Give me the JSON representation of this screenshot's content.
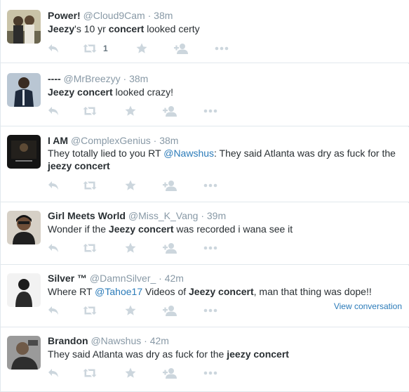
{
  "tweets": [
    {
      "fullname": "Power!",
      "username": "@Cloud9Cam",
      "sep": "·",
      "time": "38m",
      "text": [
        {
          "t": "Jeezy",
          "b": true
        },
        {
          "t": "'s 10 yr "
        },
        {
          "t": "concert",
          "b": true
        },
        {
          "t": " looked certy"
        }
      ],
      "retweet_count": "1"
    },
    {
      "fullname": "----",
      "username": "@MrBreezyy",
      "sep": "·",
      "time": "38m",
      "text": [
        {
          "t": "Jeezy concert",
          "b": true
        },
        {
          "t": " looked crazy!"
        }
      ],
      "retweet_count": ""
    },
    {
      "fullname": "I AM",
      "username": "@ComplexGenius",
      "sep": "·",
      "time": "38m",
      "text": [
        {
          "t": "They totally lied to you RT "
        },
        {
          "t": "@Nawshus",
          "m": true
        },
        {
          "t": ": They said Atlanta was dry as fuck for the "
        },
        {
          "t": "jeezy concert",
          "b": true
        }
      ],
      "retweet_count": ""
    },
    {
      "fullname": "Girl Meets World",
      "username": "@Miss_K_Vang",
      "sep": "·",
      "time": "39m",
      "text": [
        {
          "t": "Wonder if the "
        },
        {
          "t": "Jeezy concert",
          "b": true
        },
        {
          "t": " was recorded i wana see it"
        }
      ],
      "retweet_count": ""
    },
    {
      "fullname": "Silver ™",
      "username": "@DamnSilver_",
      "sep": "·",
      "time": "42m",
      "text": [
        {
          "t": "Where RT "
        },
        {
          "t": "@Tahoe17",
          "m": true
        },
        {
          "t": " Videos of "
        },
        {
          "t": "Jeezy concert",
          "b": true
        },
        {
          "t": ", man that thing was dope!!"
        }
      ],
      "retweet_count": "",
      "view_conversation": "View conversation"
    },
    {
      "fullname": "Brandon",
      "username": "@Nawshus",
      "sep": "·",
      "time": "42m",
      "text": [
        {
          "t": "They said Atlanta was dry as fuck for the "
        },
        {
          "t": "jeezy concert",
          "b": true
        }
      ],
      "retweet_count": ""
    }
  ],
  "icons": {
    "reply": "reply-icon",
    "retweet": "retweet-icon",
    "favorite": "star-icon",
    "follow": "follow-icon",
    "more": "more-icon"
  },
  "colors": {
    "name": "#292f33",
    "muted": "#8899a6",
    "icon": "#ccd6dd",
    "link": "#2b7bb9",
    "border": "#e1e8ed"
  }
}
